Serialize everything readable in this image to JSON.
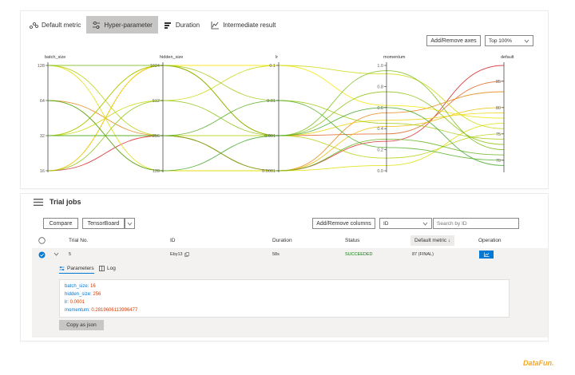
{
  "tabs": [
    {
      "label": "Default metric",
      "icon": "default-metric-icon"
    },
    {
      "label": "Hyper-parameter",
      "icon": "hyper-parameter-icon",
      "active": true
    },
    {
      "label": "Duration",
      "icon": "duration-icon"
    },
    {
      "label": "Intermediate result",
      "icon": "intermediate-result-icon"
    }
  ],
  "toolbar": {
    "add_remove_axes": "Add/Remove axes",
    "top_select": "Top 100%"
  },
  "chart_data": {
    "type": "parallel_coordinates",
    "axes": [
      {
        "name": "batch_size",
        "scale": "log2",
        "ticks": [
          "128",
          "64",
          "32",
          "16"
        ],
        "range": [
          16,
          128
        ]
      },
      {
        "name": "hidden_size",
        "scale": "log2",
        "ticks": [
          "1024",
          "512",
          "256",
          "128"
        ],
        "range": [
          128,
          1024
        ]
      },
      {
        "name": "lr",
        "scale": "log10",
        "ticks": [
          "0.1",
          "0.01",
          "0.001",
          "0.0001"
        ],
        "range": [
          0.0001,
          0.1
        ]
      },
      {
        "name": "momentum",
        "scale": "linear",
        "ticks": [
          "1.0",
          "0.8",
          "0.6",
          "0.4",
          "0.2",
          "0.0"
        ],
        "range": [
          0,
          1
        ]
      },
      {
        "name": "default",
        "scale": "linear",
        "ticks": [
          "85",
          "80",
          "75",
          "70"
        ],
        "range": [
          68,
          88
        ]
      }
    ],
    "color_scale": {
      "low": "#2ca02c",
      "mid": "#f2e600",
      "high": "#d62728"
    },
    "trials": [
      {
        "values": [
          16,
          256,
          0.0001,
          0.28,
          88
        ]
      },
      {
        "values": [
          16,
          1024,
          0.001,
          0.35,
          85
        ]
      },
      {
        "values": [
          64,
          256,
          0.0001,
          0.55,
          83
        ]
      },
      {
        "values": [
          64,
          128,
          0.0001,
          0.42,
          80
        ]
      },
      {
        "values": [
          32,
          1024,
          0.001,
          0.48,
          79
        ]
      },
      {
        "values": [
          16,
          1024,
          0.1,
          0.62,
          78
        ]
      },
      {
        "values": [
          128,
          128,
          0.0001,
          0.05,
          77
        ]
      },
      {
        "values": [
          32,
          512,
          0.1,
          0.92,
          76
        ]
      },
      {
        "values": [
          128,
          256,
          0.001,
          0.12,
          75
        ]
      },
      {
        "values": [
          32,
          1024,
          0.01,
          0.45,
          74
        ]
      },
      {
        "values": [
          16,
          512,
          0.001,
          0.75,
          73
        ]
      },
      {
        "values": [
          128,
          1024,
          0.001,
          0.95,
          72
        ]
      },
      {
        "values": [
          32,
          256,
          0.0001,
          0.3,
          71
        ]
      },
      {
        "values": [
          32,
          256,
          0.01,
          0.22,
          70
        ]
      },
      {
        "values": [
          64,
          128,
          0.001,
          0.6,
          69
        ]
      }
    ]
  },
  "jobs": {
    "title": "Trial jobs",
    "compare": "Compare",
    "tensorboard": "TensorBoard",
    "add_remove_columns": "Add/Remove columns",
    "search_by": "ID",
    "search_placeholder": "Search by ID",
    "columns": [
      "Trial No.",
      "ID",
      "Duration",
      "Status",
      "Default metric ↓",
      "Operation"
    ],
    "row": {
      "trial_no": "5",
      "id": "Eby13",
      "duration": "58s",
      "status": "SUCCEEDED",
      "metric": "87 (FINAL)"
    },
    "detail_tabs": [
      "Parameters",
      "Log"
    ],
    "params": [
      {
        "key": "batch_size:",
        "value": "16"
      },
      {
        "key": "hidden_size:",
        "value": "256"
      },
      {
        "key": "lr:",
        "value": "0.0001"
      },
      {
        "key": "momentum:",
        "value": "0.2819606113996477"
      }
    ],
    "copy_json": "Copy as json"
  },
  "logo": "DataFun."
}
